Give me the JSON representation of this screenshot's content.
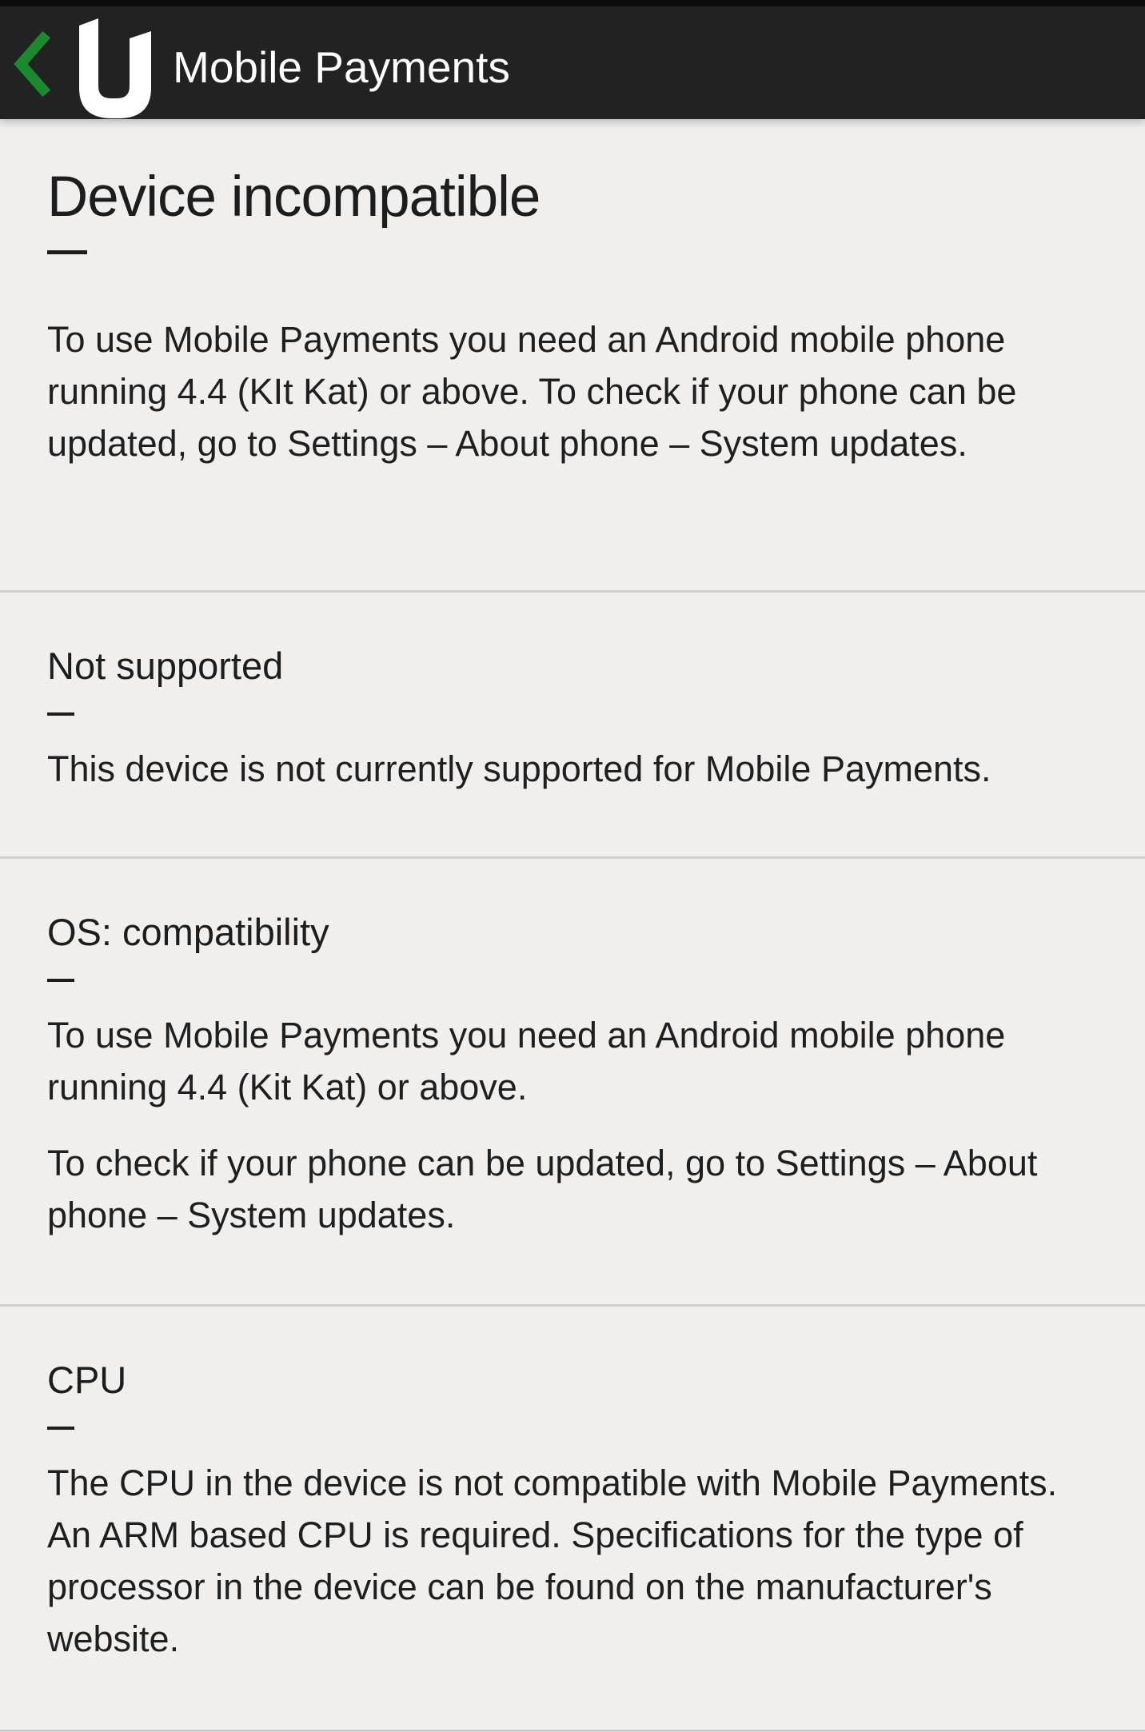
{
  "app_bar": {
    "title": "Mobile Payments",
    "back_icon": "chevron-left-icon",
    "logo_icon": "u-logo-icon",
    "accent_color": "#1a8a2e"
  },
  "main": {
    "title": "Device incompatible",
    "intro": "To use Mobile Payments you need an Android mobile phone running 4.4 (KIt Kat) or above. To check if your phone can be updated, go to Settings – About phone – System updates."
  },
  "sections": [
    {
      "title": "Not supported",
      "paragraphs": [
        "This device is not currently supported for Mobile Payments."
      ]
    },
    {
      "title": "OS: compatibility",
      "paragraphs": [
        "To use Mobile Payments you need an Android mobile phone running 4.4 (Kit Kat) or above.",
        "To check if your phone can be updated, go to Settings – About phone – System updates."
      ]
    },
    {
      "title": "CPU",
      "paragraphs": [
        "The CPU in the device is not compatible with Mobile Payments. An ARM based CPU is required. Specifications for the type of processor in the device can be found on the manufacturer's website."
      ]
    }
  ]
}
